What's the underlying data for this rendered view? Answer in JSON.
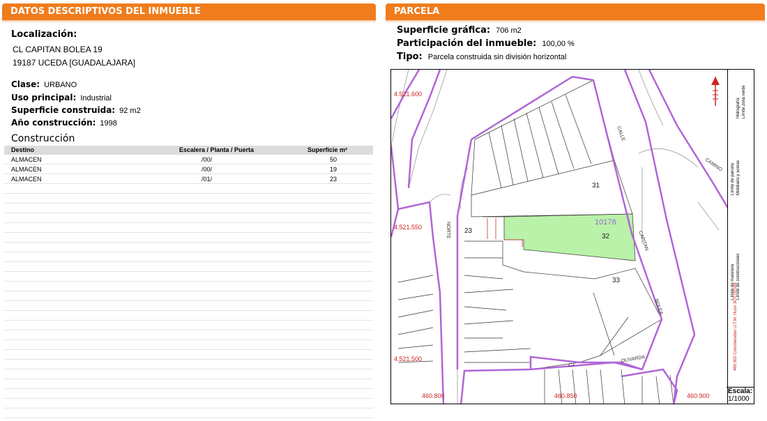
{
  "left_panel": {
    "header": "DATOS DESCRIPTIVOS DEL INMUEBLE",
    "localizacion_label": "Localización:",
    "address_line1": "CL CAPITAN BOLEA 19",
    "address_line2": "19187 UCEDA [GUADALAJARA]",
    "clase_label": "Clase:",
    "clase_value": "URBANO",
    "uso_label": "Uso principal:",
    "uso_value": "Industrial",
    "superficie_label": "Superficie construida:",
    "superficie_value": "92 m2",
    "anio_label": "Año construcción:",
    "anio_value": "1998",
    "construccion_title": "Construcción",
    "table": {
      "columns": [
        "Destino",
        "Escalera / Planta / Puerta",
        "Superficie m²"
      ],
      "rows": [
        [
          "ALMACEN",
          "/00/",
          "50"
        ],
        [
          "ALMACEN",
          "/00/",
          "19"
        ],
        [
          "ALMACEN",
          "/01/",
          "23"
        ]
      ]
    }
  },
  "right_panel": {
    "header": "PARCELA",
    "superficie_label": "Superficie gráfica:",
    "superficie_value": "706 m2",
    "participacion_label": "Participación del inmueble:",
    "participacion_value": "100,00 %",
    "tipo_label": "Tipo:",
    "tipo_value": "Parcela construida sin división horizontal"
  },
  "map": {
    "parcel_ref": "10178",
    "coord_labels": [
      "4.521.600",
      "4.521.550",
      "4.521.500",
      "460.800",
      "460.850",
      "460.900"
    ],
    "streets": [
      "CALLE",
      "CAPITAN",
      "BOLEA",
      "CAMINO",
      "NORTE",
      "OLIVARDA",
      "CJ"
    ],
    "lot_numbers": [
      "31",
      "32",
      "33",
      "23"
    ],
    "scale_label": "Escala:",
    "scale_value": "1/1000",
    "legend": [
      "Límite de manzana",
      "Límite de parcela",
      "Límite de construcciones",
      "Mobiliario y aceras",
      "Límite zona verde",
      "Hidrografía",
      "460.900 Coordenadas U.T.M. Huso 30 ETRS89"
    ],
    "colors": {
      "block_line": "#b066d6",
      "parcel_fill": "#b9f2a8",
      "coord_red": "#cc2222",
      "header_orange": "#f07c1c"
    }
  }
}
